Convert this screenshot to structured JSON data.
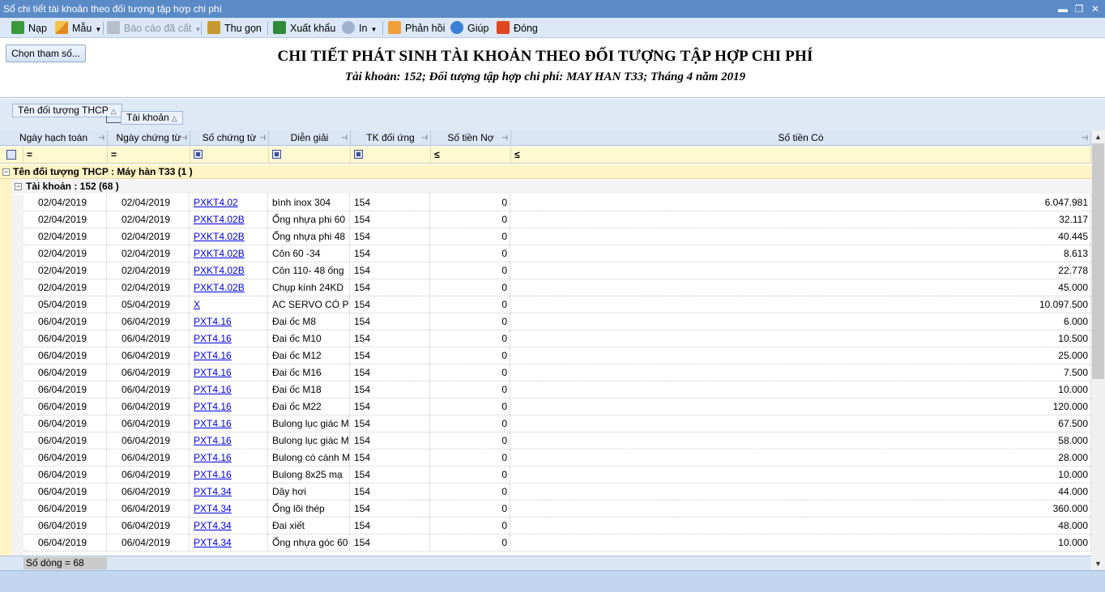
{
  "window": {
    "title": "Sổ chi tiết tài khoản theo đối tượng tập hợp chi phí",
    "controls": [
      "▬",
      "❐",
      "✕"
    ]
  },
  "toolbar": {
    "load": "Nạp",
    "template": "Mẫu",
    "saved_reports": "Báo cáo đã cất",
    "collapse": "Thu gọn",
    "export": "Xuất khẩu",
    "print": "In",
    "feedback": "Phản hồi",
    "help": "Giúp",
    "close": "Đóng"
  },
  "colors": {
    "titlebar": "#5a8bc6",
    "group_header_bg": "#fef3c5",
    "filter_row_bg": "#fff9d2",
    "link": "#0000e6"
  },
  "params_button": "Chọn tham số...",
  "report": {
    "title": "CHI TIẾT PHÁT SINH TÀI KHOẢN THEO ĐỐI TƯỢNG TẬP HỢP CHI PHÍ",
    "subtitle": "Tài khoản: 152; Đối tượng tập hợp chi phí: MAY HAN T33; Tháng 4 năm 2019"
  },
  "group_panel": {
    "chip1": "Tên đối tượng THCP",
    "chip2": "Tài khoản",
    "sort_glyph": "△"
  },
  "columns": {
    "posting_date": "Ngày hạch toán",
    "doc_date": "Ngày chứng từ",
    "doc_no": "Số chứng từ",
    "description": "Diễn giải",
    "contra_account": "TK đối ứng",
    "debit": "Số tiền Nợ",
    "credit": "Số tiền Có",
    "pin_glyph": "⊣"
  },
  "filter": {
    "eq": "=",
    "le": "≤"
  },
  "groups": {
    "level1": "Tên đối tượng THCP : Máy hàn T33 (1 )",
    "level2": "Tài khoản : 152 (68 )",
    "expander": "−"
  },
  "rows": [
    {
      "posting_date": "02/04/2019",
      "doc_date": "02/04/2019",
      "doc_no": "PXKT4.02",
      "description": "bình inox 304",
      "contra": "154",
      "debit": "0",
      "credit": "6.047.981"
    },
    {
      "posting_date": "02/04/2019",
      "doc_date": "02/04/2019",
      "doc_no": "PXKT4.02B",
      "description": "Ống nhựa phi 60",
      "contra": "154",
      "debit": "0",
      "credit": "32.117"
    },
    {
      "posting_date": "02/04/2019",
      "doc_date": "02/04/2019",
      "doc_no": "PXKT4.02B",
      "description": "Ống nhựa phi 48",
      "contra": "154",
      "debit": "0",
      "credit": "40.445"
    },
    {
      "posting_date": "02/04/2019",
      "doc_date": "02/04/2019",
      "doc_no": "PXKT4.02B",
      "description": "Côn 60 -34",
      "contra": "154",
      "debit": "0",
      "credit": "8.613"
    },
    {
      "posting_date": "02/04/2019",
      "doc_date": "02/04/2019",
      "doc_no": "PXKT4.02B",
      "description": "Côn 110- 48 ống",
      "contra": "154",
      "debit": "0",
      "credit": "22.778"
    },
    {
      "posting_date": "02/04/2019",
      "doc_date": "02/04/2019",
      "doc_no": "PXKT4.02B",
      "description": "Chụp kính 24KD",
      "contra": "154",
      "debit": "0",
      "credit": "45.000"
    },
    {
      "posting_date": "05/04/2019",
      "doc_date": "05/04/2019",
      "doc_no": "X",
      "description": "AC SERVO CÓ P",
      "contra": "154",
      "debit": "0",
      "credit": "10.097.500"
    },
    {
      "posting_date": "06/04/2019",
      "doc_date": "06/04/2019",
      "doc_no": "PXT4.16",
      "description": "Đai ốc M8",
      "contra": "154",
      "debit": "0",
      "credit": "6.000"
    },
    {
      "posting_date": "06/04/2019",
      "doc_date": "06/04/2019",
      "doc_no": "PXT4.16",
      "description": "Đai ốc M10",
      "contra": "154",
      "debit": "0",
      "credit": "10.500"
    },
    {
      "posting_date": "06/04/2019",
      "doc_date": "06/04/2019",
      "doc_no": "PXT4.16",
      "description": "Đai ốc M12",
      "contra": "154",
      "debit": "0",
      "credit": "25.000"
    },
    {
      "posting_date": "06/04/2019",
      "doc_date": "06/04/2019",
      "doc_no": "PXT4.16",
      "description": "Đai ốc M16",
      "contra": "154",
      "debit": "0",
      "credit": "7.500"
    },
    {
      "posting_date": "06/04/2019",
      "doc_date": "06/04/2019",
      "doc_no": "PXT4.16",
      "description": "Đai ốc M18",
      "contra": "154",
      "debit": "0",
      "credit": "10.000"
    },
    {
      "posting_date": "06/04/2019",
      "doc_date": "06/04/2019",
      "doc_no": "PXT4.16",
      "description": "Đai ốc M22",
      "contra": "154",
      "debit": "0",
      "credit": "120.000"
    },
    {
      "posting_date": "06/04/2019",
      "doc_date": "06/04/2019",
      "doc_no": "PXT4.16",
      "description": "Bulong lục giác M",
      "contra": "154",
      "debit": "0",
      "credit": "67.500"
    },
    {
      "posting_date": "06/04/2019",
      "doc_date": "06/04/2019",
      "doc_no": "PXT4.16",
      "description": "Bulong lục giác M",
      "contra": "154",
      "debit": "0",
      "credit": "58.000"
    },
    {
      "posting_date": "06/04/2019",
      "doc_date": "06/04/2019",
      "doc_no": "PXT4.16",
      "description": "Bulong có cánh M",
      "contra": "154",
      "debit": "0",
      "credit": "28.000"
    },
    {
      "posting_date": "06/04/2019",
      "doc_date": "06/04/2019",
      "doc_no": "PXT4.16",
      "description": "Bulong 8x25 mạ",
      "contra": "154",
      "debit": "0",
      "credit": "10.000"
    },
    {
      "posting_date": "06/04/2019",
      "doc_date": "06/04/2019",
      "doc_no": "PXT4.34",
      "description": "Dây hơi",
      "contra": "154",
      "debit": "0",
      "credit": "44.000"
    },
    {
      "posting_date": "06/04/2019",
      "doc_date": "06/04/2019",
      "doc_no": "PXT4.34",
      "description": "Ống lõi thép",
      "contra": "154",
      "debit": "0",
      "credit": "360.000"
    },
    {
      "posting_date": "06/04/2019",
      "doc_date": "06/04/2019",
      "doc_no": "PXT4.34",
      "description": "Đai xiết",
      "contra": "154",
      "debit": "0",
      "credit": "48.000"
    },
    {
      "posting_date": "06/04/2019",
      "doc_date": "06/04/2019",
      "doc_no": "PXT4.34",
      "description": "Ống nhựa góc 60",
      "contra": "154",
      "debit": "0",
      "credit": "10.000"
    }
  ],
  "footer": {
    "row_count": "Số dòng = 68"
  },
  "scroll": {
    "up": "▲",
    "down": "▼"
  }
}
